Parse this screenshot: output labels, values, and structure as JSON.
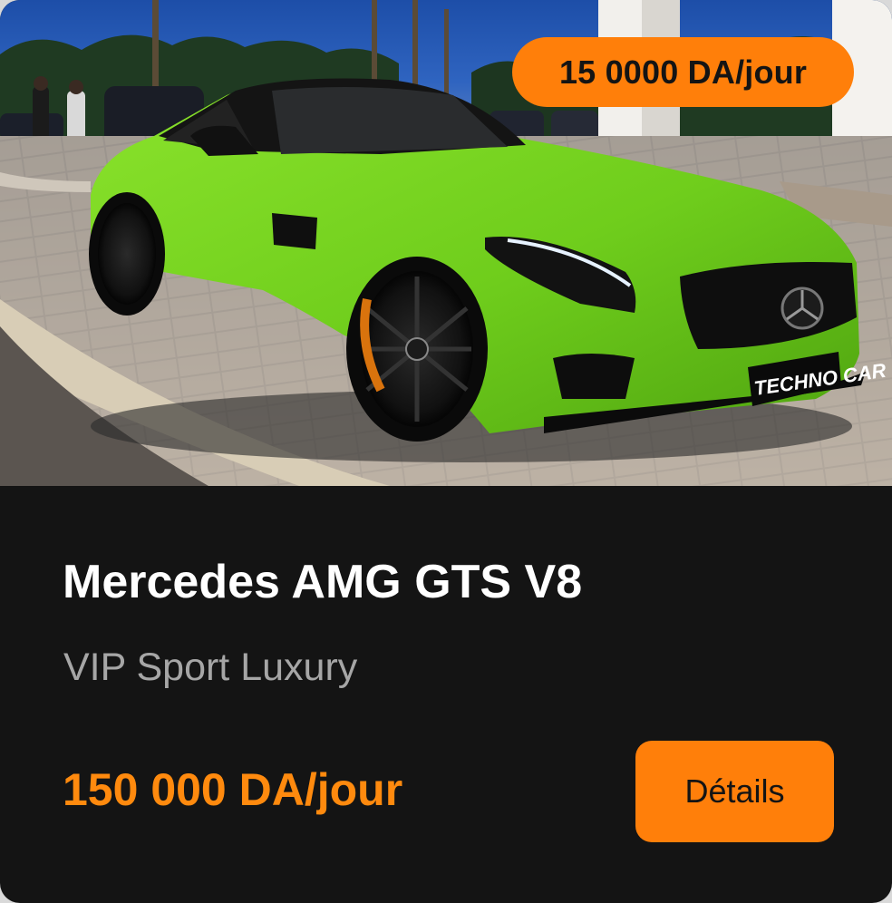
{
  "card": {
    "image_alt": "Green Mercedes AMG GT coupe parked on paved driveway",
    "plate_text": "TECHNO CAR",
    "badge_price": "15 0000 DA/jour",
    "title": "Mercedes AMG GTS V8",
    "subtitle": "VIP Sport Luxury",
    "price": "150 000 DA/jour",
    "details_label": "Détails"
  },
  "colors": {
    "accent": "#ff7f0a",
    "card_background": "#141414",
    "title": "#ffffff",
    "subtitle": "#a6a6a6",
    "car_body": "#7ad321"
  }
}
